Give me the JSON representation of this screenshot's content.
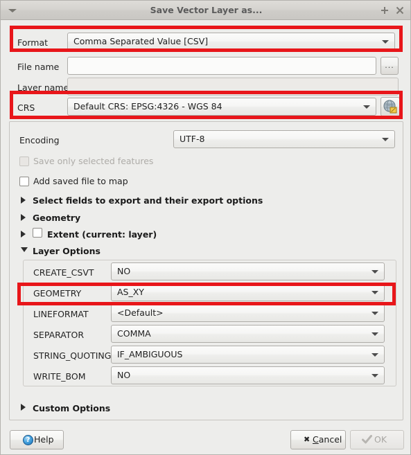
{
  "window": {
    "title": "Save Vector Layer as...",
    "menu_icon": "caret-down-icon",
    "maximize_icon": "plus-icon",
    "close_icon": "close-icon"
  },
  "top_form": {
    "format": {
      "label": "Format",
      "value": "Comma Separated Value [CSV]",
      "highlighted": true
    },
    "file_name": {
      "label": "File name",
      "value": "",
      "browse_label": "..."
    },
    "layer_name": {
      "label": "Layer name",
      "value": "",
      "disabled": true
    },
    "crs": {
      "label": "CRS",
      "value": "Default CRS: EPSG:4326 - WGS 84",
      "select_icon": "globe-crs-icon",
      "highlighted": true
    }
  },
  "options": {
    "encoding": {
      "label": "Encoding",
      "value": "UTF-8"
    },
    "save_only_selected": {
      "label": "Save only selected features",
      "checked": false,
      "disabled": true
    },
    "add_saved_file_to_map": {
      "label": "Add saved file to map",
      "checked": false,
      "disabled": false
    },
    "sections": [
      {
        "label": "Select fields to export and their export options",
        "expanded": false,
        "has_checkbox": false
      },
      {
        "label": "Geometry",
        "expanded": false,
        "has_checkbox": false
      },
      {
        "label": "Extent (current: layer)",
        "expanded": false,
        "has_checkbox": true,
        "checked": false
      },
      {
        "label": "Layer Options",
        "expanded": true,
        "has_checkbox": false
      }
    ],
    "layer_options": [
      {
        "name": "CREATE_CSVT",
        "value": "NO",
        "highlighted": false
      },
      {
        "name": "GEOMETRY",
        "value": "AS_XY",
        "highlighted": true
      },
      {
        "name": "LINEFORMAT",
        "value": "<Default>",
        "highlighted": false
      },
      {
        "name": "SEPARATOR",
        "value": "COMMA",
        "highlighted": false
      },
      {
        "name": "STRING_QUOTING",
        "value": "IF_AMBIGUOUS",
        "highlighted": false
      },
      {
        "name": "WRITE_BOM",
        "value": "NO",
        "highlighted": false
      }
    ],
    "custom_options": {
      "label": "Custom Options",
      "expanded": false
    }
  },
  "footer": {
    "help": {
      "label": "Help",
      "icon": "help-question-icon"
    },
    "cancel": {
      "label": "Cancel",
      "accel": "C",
      "icon": "cross-icon"
    },
    "ok": {
      "label": "OK",
      "icon": "check-icon",
      "disabled": true
    }
  },
  "colors": {
    "highlight": "#e8161a",
    "window_bg": "#ededeb",
    "titlebar_text": "#5b5b5b"
  }
}
